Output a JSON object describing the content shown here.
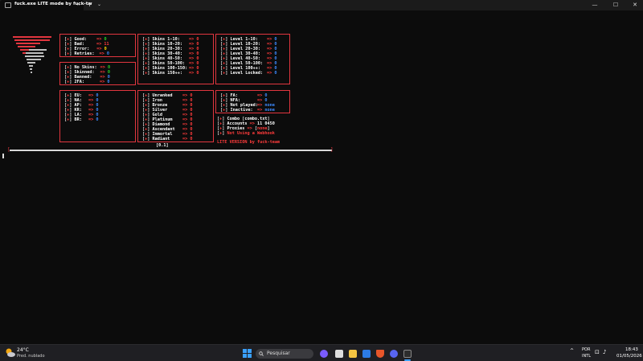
{
  "window": {
    "tab_title": "fuck.exe LITE mode by fuck-tw",
    "tab_close": "×",
    "new_tab": "+",
    "tab_menu": "⌄",
    "minimize": "—",
    "maximize": "☐",
    "close": "✕"
  },
  "stats": {
    "good": {
      "label": "Good:",
      "value": "0"
    },
    "bad": {
      "label": "Bad:",
      "value": "11"
    },
    "error": {
      "label": "Error:",
      "value": "0"
    },
    "retries": {
      "label": "Retries:",
      "value": "0"
    }
  },
  "skins_status": {
    "no_skins": {
      "label": "No Skins:",
      "value": "0"
    },
    "skinned": {
      "label": "Skinned:",
      "value": "0"
    },
    "banned": {
      "label": "Banned:",
      "value": "0"
    },
    "twofa": {
      "label": "2FA:",
      "value": "0"
    }
  },
  "skins": [
    {
      "label": "Skins 1-10:",
      "value": "0"
    },
    {
      "label": "Skins 10-20:",
      "value": "0"
    },
    {
      "label": "Skins 20-30:",
      "value": "0"
    },
    {
      "label": "Skins 30-40:",
      "value": "0"
    },
    {
      "label": "Skins 40-50:",
      "value": "0"
    },
    {
      "label": "Skins 50-100:",
      "value": "0"
    },
    {
      "label": "Skins 100-150:",
      "value": "0"
    },
    {
      "label": "Skins 150++:",
      "value": "0"
    }
  ],
  "levels": [
    {
      "label": "Level 1-10:",
      "value": "0"
    },
    {
      "label": "Level 10-20:",
      "value": "0"
    },
    {
      "label": "Level 20-30:",
      "value": "0"
    },
    {
      "label": "Level 30-40:",
      "value": "0"
    },
    {
      "label": "Level 40-50:",
      "value": "0"
    },
    {
      "label": "Level 50-100:",
      "value": "0"
    },
    {
      "label": "Level 100++:",
      "value": "0"
    },
    {
      "label": "Level Locked:",
      "value": "0"
    }
  ],
  "regions": [
    {
      "label": "EU:",
      "value": "0"
    },
    {
      "label": "NA:",
      "value": "0"
    },
    {
      "label": "AP:",
      "value": "0"
    },
    {
      "label": "KR:",
      "value": "0"
    },
    {
      "label": "LA:",
      "value": "0"
    },
    {
      "label": "BR:",
      "value": "0"
    }
  ],
  "ranks": [
    {
      "label": "Unranked",
      "value": "0"
    },
    {
      "label": "Iron",
      "value": "0"
    },
    {
      "label": "Bronze",
      "value": "0"
    },
    {
      "label": "Silver",
      "value": "0"
    },
    {
      "label": "Gold",
      "value": "0"
    },
    {
      "label": "Platinum",
      "value": "0"
    },
    {
      "label": "Diamond",
      "value": "0"
    },
    {
      "label": "Ascendant",
      "value": "0"
    },
    {
      "label": "Immortal",
      "value": "0"
    },
    {
      "label": "Radiant",
      "value": "0"
    }
  ],
  "account_flags": [
    {
      "label": "FA:",
      "value": "0"
    },
    {
      "label": "NFA:",
      "value": "0"
    },
    {
      "label": "Not played:",
      "value": "none"
    },
    {
      "label": "Inactive:",
      "value": "none"
    }
  ],
  "info": {
    "combo": {
      "label": "Combo",
      "value": "combo.txt"
    },
    "accounts": {
      "label": "Accounts",
      "value": "11 0450"
    },
    "proxies": {
      "label": "Proxies",
      "value": "none"
    },
    "webhook": "Not Using a Webhook",
    "version": "LITE VERSION by fuck-team"
  },
  "markers": {
    "open": "[",
    "mark": "+",
    "close": "]",
    "arrow": "=>"
  },
  "progress": {
    "label": "[0.1]",
    "left": "[",
    "right": "]"
  },
  "taskbar": {
    "temp": "24°C",
    "weather": "Pred. nublado",
    "search_placeholder": "Pesquisar",
    "lang_1": "POR",
    "lang_2": "INTL",
    "time": "18:43",
    "date": "01/05/2026"
  },
  "colors": {
    "accent": "#e2363f",
    "value_green": "#25d425",
    "value_blue": "#3d8bff"
  }
}
